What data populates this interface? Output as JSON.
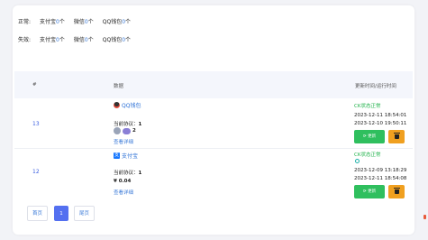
{
  "stats": {
    "normal_label": "正常:",
    "error_label": "失效:",
    "alipay_label": "支付宝",
    "wechat_label": "微信",
    "qq_label": "QQ钱包",
    "normal": {
      "alipay": "0",
      "wechat": "0",
      "qq": "0"
    },
    "error": {
      "alipay": "0",
      "wechat": "0",
      "qq": "0"
    },
    "unit": "个"
  },
  "table": {
    "headers": {
      "id": "#",
      "data": "数据",
      "time": "更新时间/运行时间"
    },
    "rows": [
      {
        "id": "13",
        "channel": "QQ钱包",
        "channel_icon": "qq-icon",
        "protocol_label": "当前协议：",
        "protocol_value": "1",
        "extra_count": "2",
        "detail_link": "查看详细",
        "status": "CK状态正常",
        "times": [
          "2023-12-11 18:54:01",
          "2023-12-10 19:50:11"
        ],
        "update_btn": "⟳ 更新"
      },
      {
        "id": "12",
        "channel": "支付宝",
        "channel_icon": "alipay-icon",
        "protocol_label": "当前协议：",
        "protocol_value": "1",
        "amount": "¥ 0.04",
        "detail_link": "查看详细",
        "status": "CK状态正常",
        "times": [
          "2023-12-09 13:18:29",
          "2023-12-11 18:54:08"
        ],
        "update_btn": "⟳ 更新"
      }
    ]
  },
  "pagination": {
    "first": "首页",
    "current": "1",
    "last": "尾页"
  },
  "colors": {
    "accent": "#5470f0",
    "success": "#2fbf5e",
    "warning": "#f0a020",
    "link": "#3a7ad8"
  }
}
